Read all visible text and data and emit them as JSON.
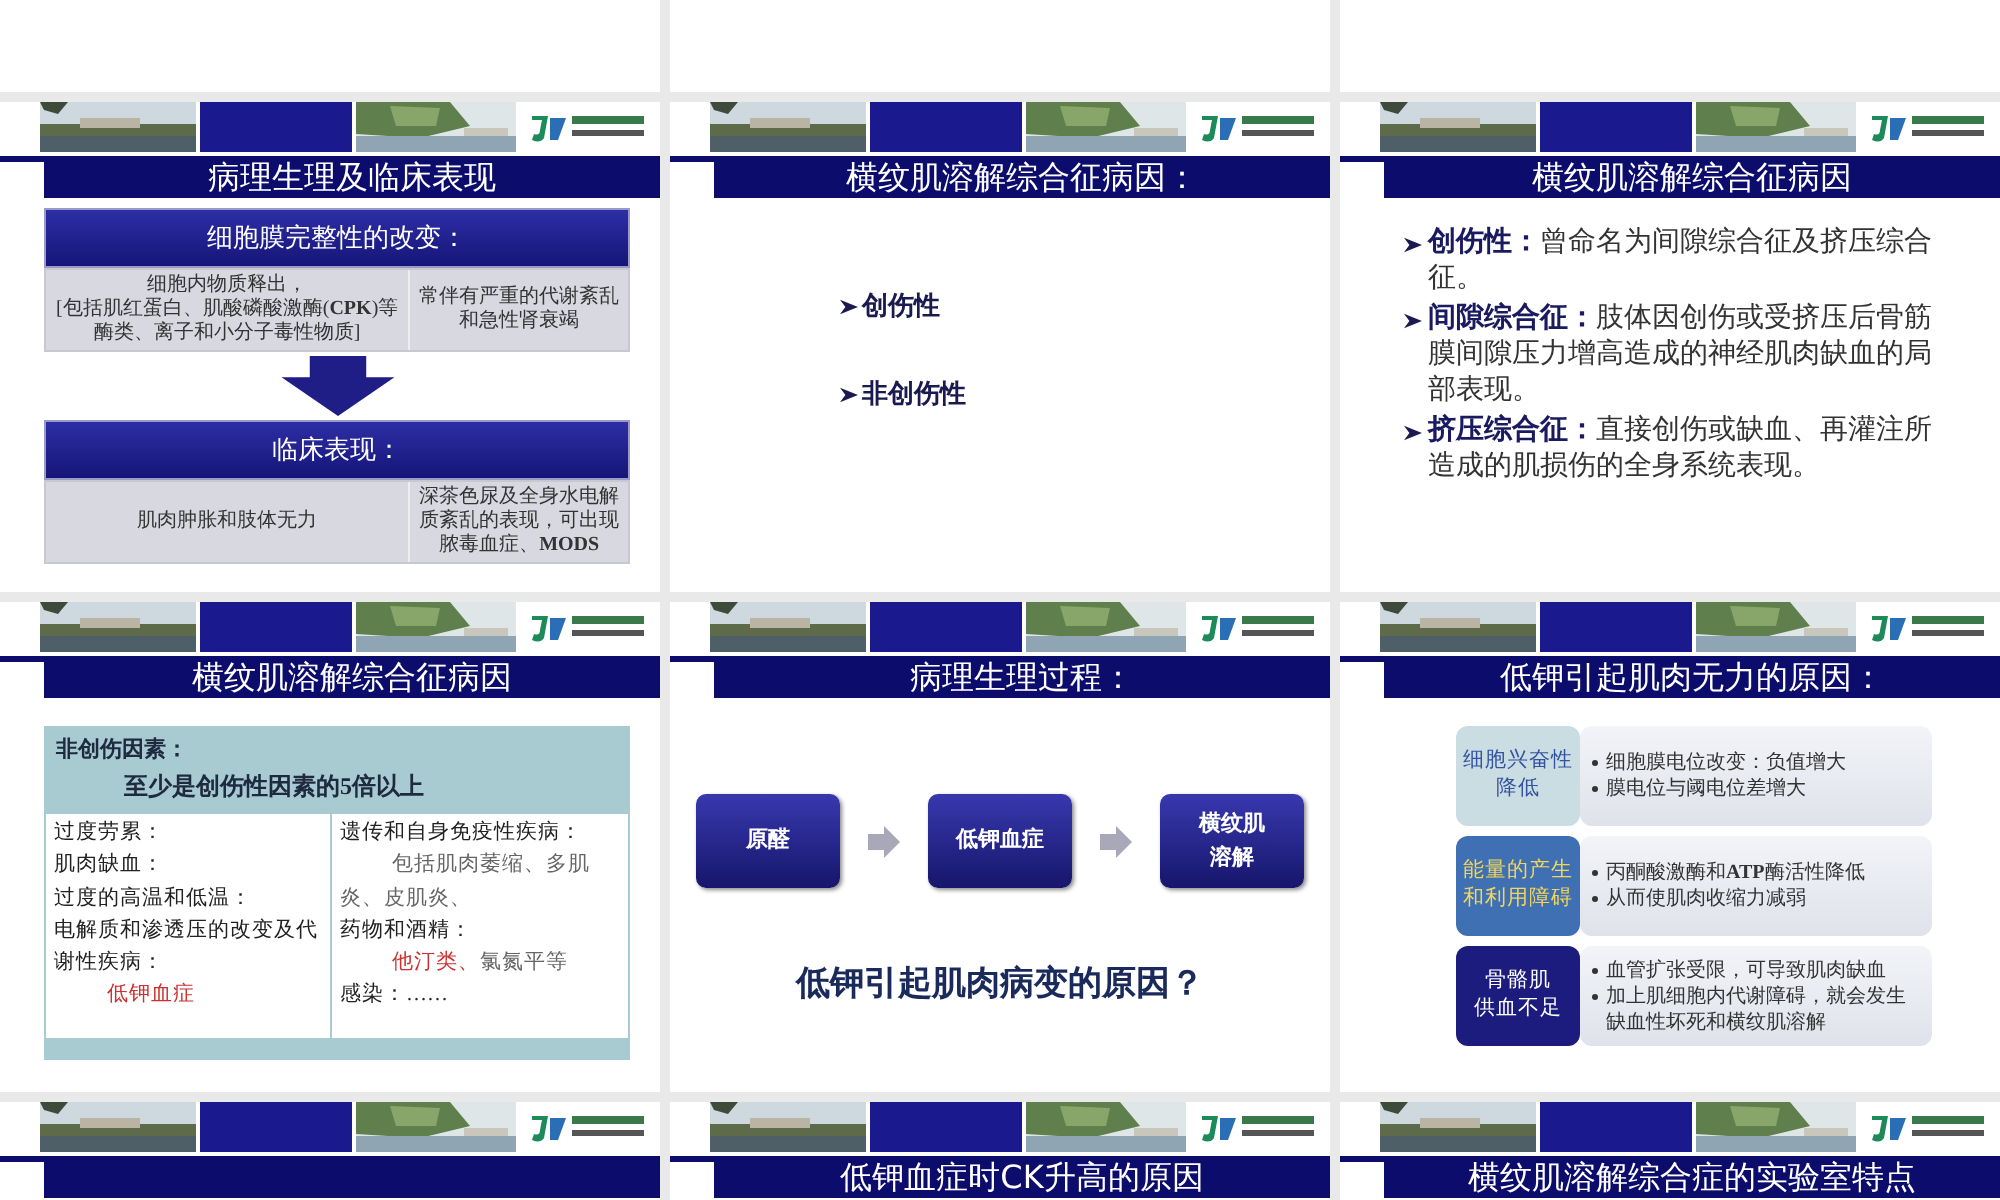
{
  "slides": [
    {
      "kind": "blank"
    },
    {
      "kind": "blank"
    },
    {
      "kind": "blank"
    },
    {
      "kind": "tables",
      "title": "病理生理及临床表现",
      "sections": [
        {
          "heading": "细胞膜完整性的改变：",
          "cells": [
            {
              "text": "细胞内物质释出，",
              "note": "[包括肌红蛋白、肌酸磷酸激酶(**CPK**)等酶类、离子和小分子毒性物质]"
            },
            {
              "text": "常伴有严重的代谢紊乱和急性肾衰竭"
            }
          ]
        },
        {
          "heading": "临床表现：",
          "cells": [
            {
              "text": "肌肉肿胀和肢体无力"
            },
            {
              "text": "深茶色尿及全身水电解质紊乱的表现，可出现脓毒血症、**MODS**"
            }
          ]
        }
      ]
    },
    {
      "kind": "bullets",
      "title": "横纹肌溶解综合征病因：",
      "items": [
        "创伤性",
        "非创伤性"
      ]
    },
    {
      "kind": "definitions",
      "title": "横纹肌溶解综合征病因",
      "items": [
        "**创伤性：**曾命名为间隙综合征及挤压综合征。",
        "**间隙综合征：**肢体因创伤或受挤压后骨筋膜间隙压力增高造成的神经肌肉缺血的局部表现。",
        "**挤压综合征：**直接创伤或缺血、再灌注所造成的肌损伤的全身系统表现。"
      ]
    },
    {
      "kind": "factors",
      "title": "横纹肌溶解综合征病因",
      "header": [
        "非创伤因素：",
        "至少是创伤性因素的5倍以上"
      ],
      "columns": [
        [
          {
            "kind": "label",
            "parts": [
              {
                "text": "过度劳累：",
                "highlight": false
              }
            ]
          },
          {
            "kind": "label",
            "parts": [
              {
                "text": "肌肉缺血：",
                "highlight": false
              }
            ]
          },
          {
            "kind": "label",
            "parts": [
              {
                "text": "过度的高温和低温：",
                "highlight": false
              }
            ]
          },
          {
            "kind": "label",
            "parts": [
              {
                "text": "电解质和渗透压的改变及代谢性疾病：",
                "highlight": false
              }
            ]
          },
          {
            "kind": "example",
            "parts": [
              {
                "text": "低钾血症",
                "highlight": true
              }
            ]
          }
        ],
        [
          {
            "kind": "label",
            "parts": [
              {
                "text": "遗传和自身免疫性疾病：",
                "highlight": false
              }
            ]
          },
          {
            "kind": "example",
            "parts": [
              {
                "text": "包括肌肉萎缩、多肌炎、皮肌炎、",
                "highlight": false
              }
            ]
          },
          {
            "kind": "label",
            "parts": [
              {
                "text": "药物和酒精：",
                "highlight": false
              }
            ]
          },
          {
            "kind": "example",
            "parts": [
              {
                "text": "他汀类、",
                "highlight": true
              },
              {
                "text": "氯氮平等",
                "highlight": false
              }
            ]
          },
          {
            "kind": "label",
            "parts": [
              {
                "text": "感染：……",
                "highlight": false
              }
            ]
          }
        ]
      ]
    },
    {
      "kind": "process",
      "title": "病理生理过程：",
      "steps": [
        {
          "lines": [
            "原醛"
          ]
        },
        {
          "lines": [
            "低钾血症"
          ]
        },
        {
          "lines": [
            "横纹肌",
            "溶解"
          ]
        }
      ],
      "question": "低钾引起肌肉病变的原因？"
    },
    {
      "kind": "causes",
      "title": "低钾引起肌肉无力的原因：",
      "rows": [
        {
          "color": "#c9dde3",
          "label": [
            "细胞兴奋性",
            "降低"
          ],
          "points": [
            "细胞膜电位改变：负值增大",
            "膜电位与阈电位差增大"
          ]
        },
        {
          "color": "#3f70b4",
          "label": [
            "能量的产生",
            "和利用障碍"
          ],
          "points": [
            "丙酮酸激酶和**ATP**酶活性降低",
            "从而使肌肉收缩力减弱"
          ]
        },
        {
          "color": "#1c1c7e",
          "label": [
            "骨骼肌",
            "供血不足"
          ],
          "points": [
            "血管扩张受限，可导致肌肉缺血",
            "加上肌细胞内代谢障碍，就会发生缺血性坏死和横纹肌溶解"
          ]
        }
      ]
    },
    {
      "kind": "header"
    },
    {
      "kind": "header",
      "title": "低钾血症时CK升高的原因"
    },
    {
      "kind": "header",
      "title": "横纹肌溶解综合症的实验室特点"
    }
  ]
}
